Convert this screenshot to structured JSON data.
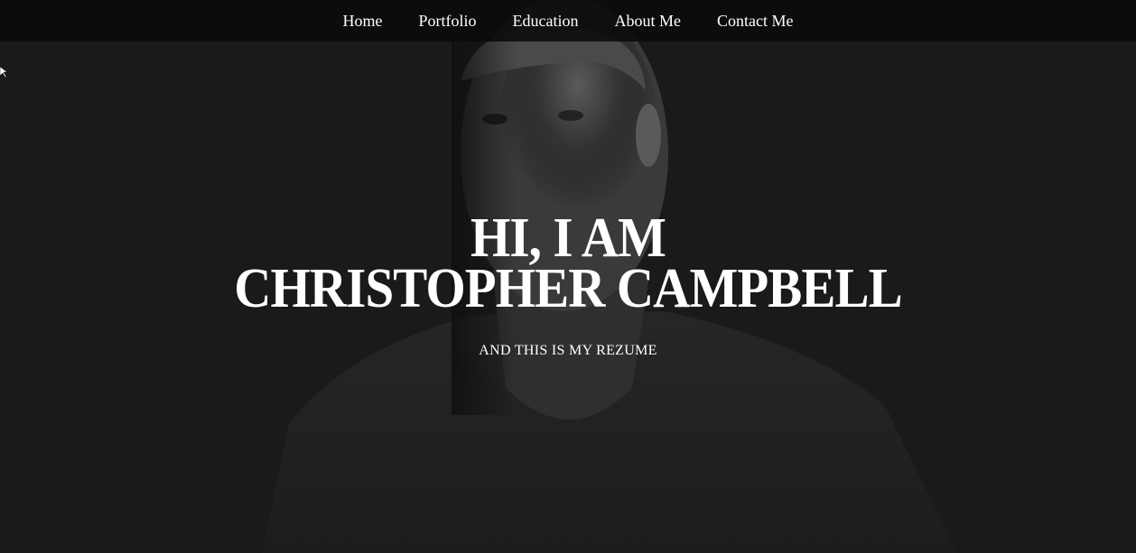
{
  "nav": {
    "items": [
      {
        "label": "Home"
      },
      {
        "label": "Portfolio"
      },
      {
        "label": "Education"
      },
      {
        "label": "About Me"
      },
      {
        "label": "Contact Me"
      }
    ]
  },
  "hero": {
    "title_line1": "HI, I AM",
    "title_line2": "CHRISTOPHER CAMPBELL",
    "subtitle": "AND THIS IS MY REZUME"
  },
  "colors": {
    "background": "#1a1a1a",
    "navbar": "#0a0a0a",
    "text": "#ffffff"
  }
}
